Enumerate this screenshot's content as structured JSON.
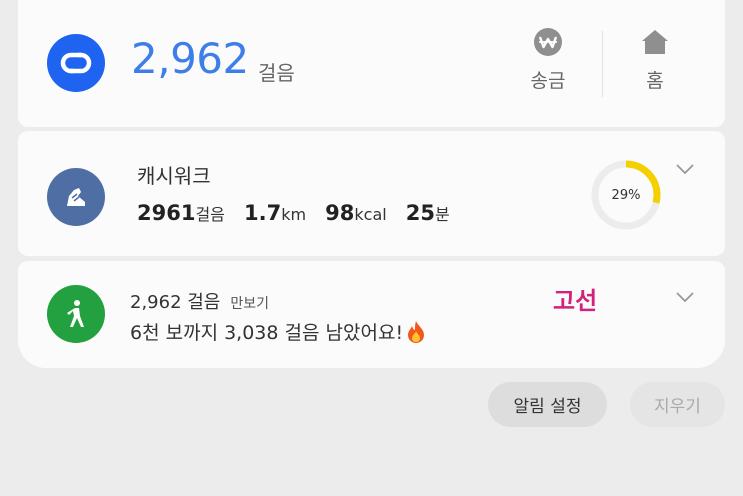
{
  "top": {
    "steps": "2,962",
    "steps_unit": "걸음",
    "send_label": "송금",
    "home_label": "홈",
    "brand_color": "#1e64f0",
    "steps_color": "#3d7ee8"
  },
  "cashwalk": {
    "title": "캐시워크",
    "stats": [
      {
        "value": "2961",
        "unit": "걸음"
      },
      {
        "value": "1.7",
        "unit": "km"
      },
      {
        "value": "98",
        "unit": "kcal"
      },
      {
        "value": "25",
        "unit": "분"
      }
    ],
    "progress_label": "29%",
    "progress": 0.29,
    "progress_color": "#f5d000"
  },
  "pedometer": {
    "steps": "2,962 걸음",
    "tag": "만보기",
    "message": "6천 보까지 3,038 걸음 남았어요!",
    "annotation": "고선",
    "icon_color": "#23a141"
  },
  "actions": {
    "alarm_settings": "알림 설정",
    "clear": "지우기"
  }
}
